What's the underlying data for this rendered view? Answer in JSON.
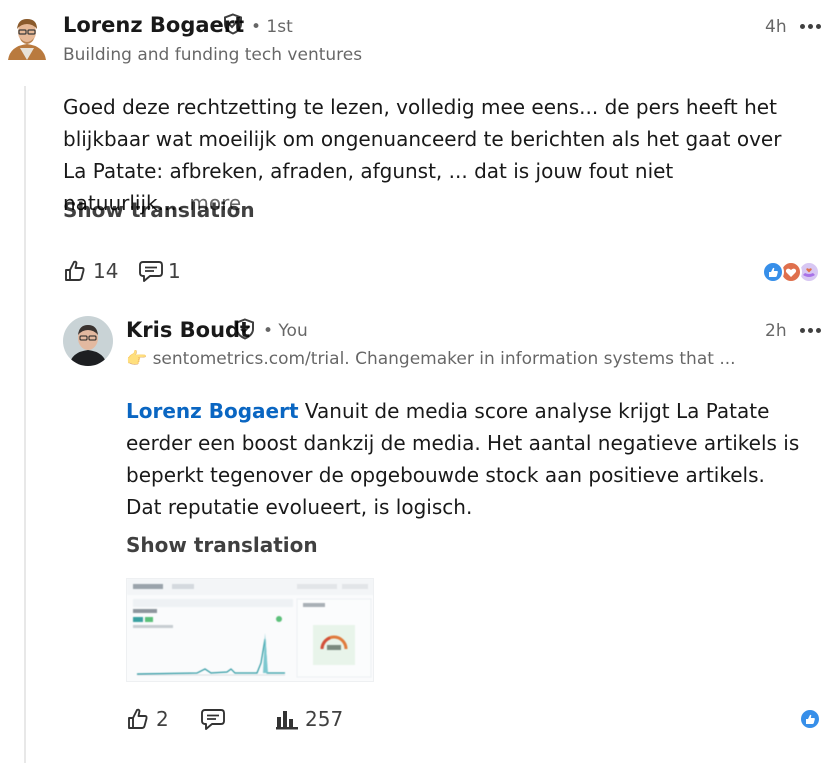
{
  "comment": {
    "author": "Lorenz Bogaert",
    "degree": "• 1st",
    "headline": "Building and funding tech ventures",
    "time": "4h",
    "text": "Goed deze rechtzetting te lezen, volledig mee eens... de pers heeft het blijkbaar wat moeilijk om ongenuanceerd te berichten als het gaat over La Patate: afbreken, afraden, afgunst, ... dat is jouw fout niet natuurlijk....",
    "see_more": "more",
    "show_translation": "Show translation",
    "like_count": "14",
    "reply_count": "1",
    "reaction_icons": [
      "like-reaction",
      "love-reaction",
      "support-reaction"
    ]
  },
  "reply": {
    "author": "Kris Boudt",
    "degree": "• You",
    "headline_emoji": "👉",
    "headline": "sentometrics.com/trial. Changemaker in information systems that ...",
    "time": "2h",
    "mention": "Lorenz Bogaert",
    "text": " Vanuit de media score analyse krijgt La Patate eerder een boost dankzij de media. Het aantal negatieve artikels is beperkt tegenover de opgebouwde stock aan positieve artikels. Dat reputatie evolueert, is logisch.",
    "show_translation": "Show translation",
    "like_count": "2",
    "impressions_count": "257",
    "reaction_icons": [
      "like-reaction"
    ]
  },
  "colors": {
    "link_blue": "#0a66c2",
    "like_blue": "#378fe9",
    "love_red": "#df704d",
    "support_purple": "#a872e8"
  }
}
